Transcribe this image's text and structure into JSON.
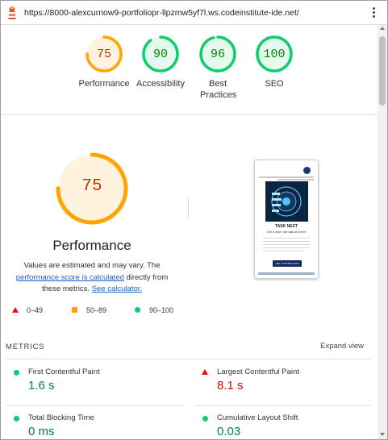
{
  "url_bar": {
    "url": "https://8000-alexcurnow9-portfoliopr-llpzmw5yf7l.ws.codeinstitute-ide.net/"
  },
  "summary_gauges": [
    {
      "label": "Performance",
      "score": 75,
      "color": "#ffa400",
      "text_color": "#c33300",
      "fill": "#fff3e0"
    },
    {
      "label": "Accessibility",
      "score": 90,
      "color": "#0cce6b",
      "text_color": "#008800",
      "fill": "#e6f9ee"
    },
    {
      "label": "Best Practices",
      "score": 96,
      "color": "#0cce6b",
      "text_color": "#008800",
      "fill": "#e6f9ee"
    },
    {
      "label": "SEO",
      "score": 100,
      "color": "#0cce6b",
      "text_color": "#008800",
      "fill": "#e6f9ee"
    }
  ],
  "detail": {
    "title": "Performance",
    "score": 75,
    "note_prefix": "Values are estimated and may vary. The ",
    "note_link1": "performance score is calculated",
    "note_middle": " directly from these metrics. ",
    "note_link2": "See calculator."
  },
  "screenshot_thumb": {
    "heading": "TASK NEST",
    "subheading": "Get it done, one task at a time",
    "cta": "GET STARTED NOW"
  },
  "legend": [
    {
      "shape": "triangle",
      "range": "0–49",
      "color": "#eb0f00"
    },
    {
      "shape": "square",
      "range": "50–89",
      "color": "#ffa400"
    },
    {
      "shape": "circle",
      "range": "90–100",
      "color": "#0cce6b"
    }
  ],
  "metrics": {
    "title": "METRICS",
    "expand_label": "Expand view",
    "items": [
      {
        "name": "First Contentful Paint",
        "value": "1.6 s",
        "status": "pass"
      },
      {
        "name": "Largest Contentful Paint",
        "value": "8.1 s",
        "status": "fail"
      },
      {
        "name": "Total Blocking Time",
        "value": "0 ms",
        "status": "pass"
      },
      {
        "name": "Cumulative Layout Shift",
        "value": "0.03",
        "status": "pass"
      }
    ]
  }
}
